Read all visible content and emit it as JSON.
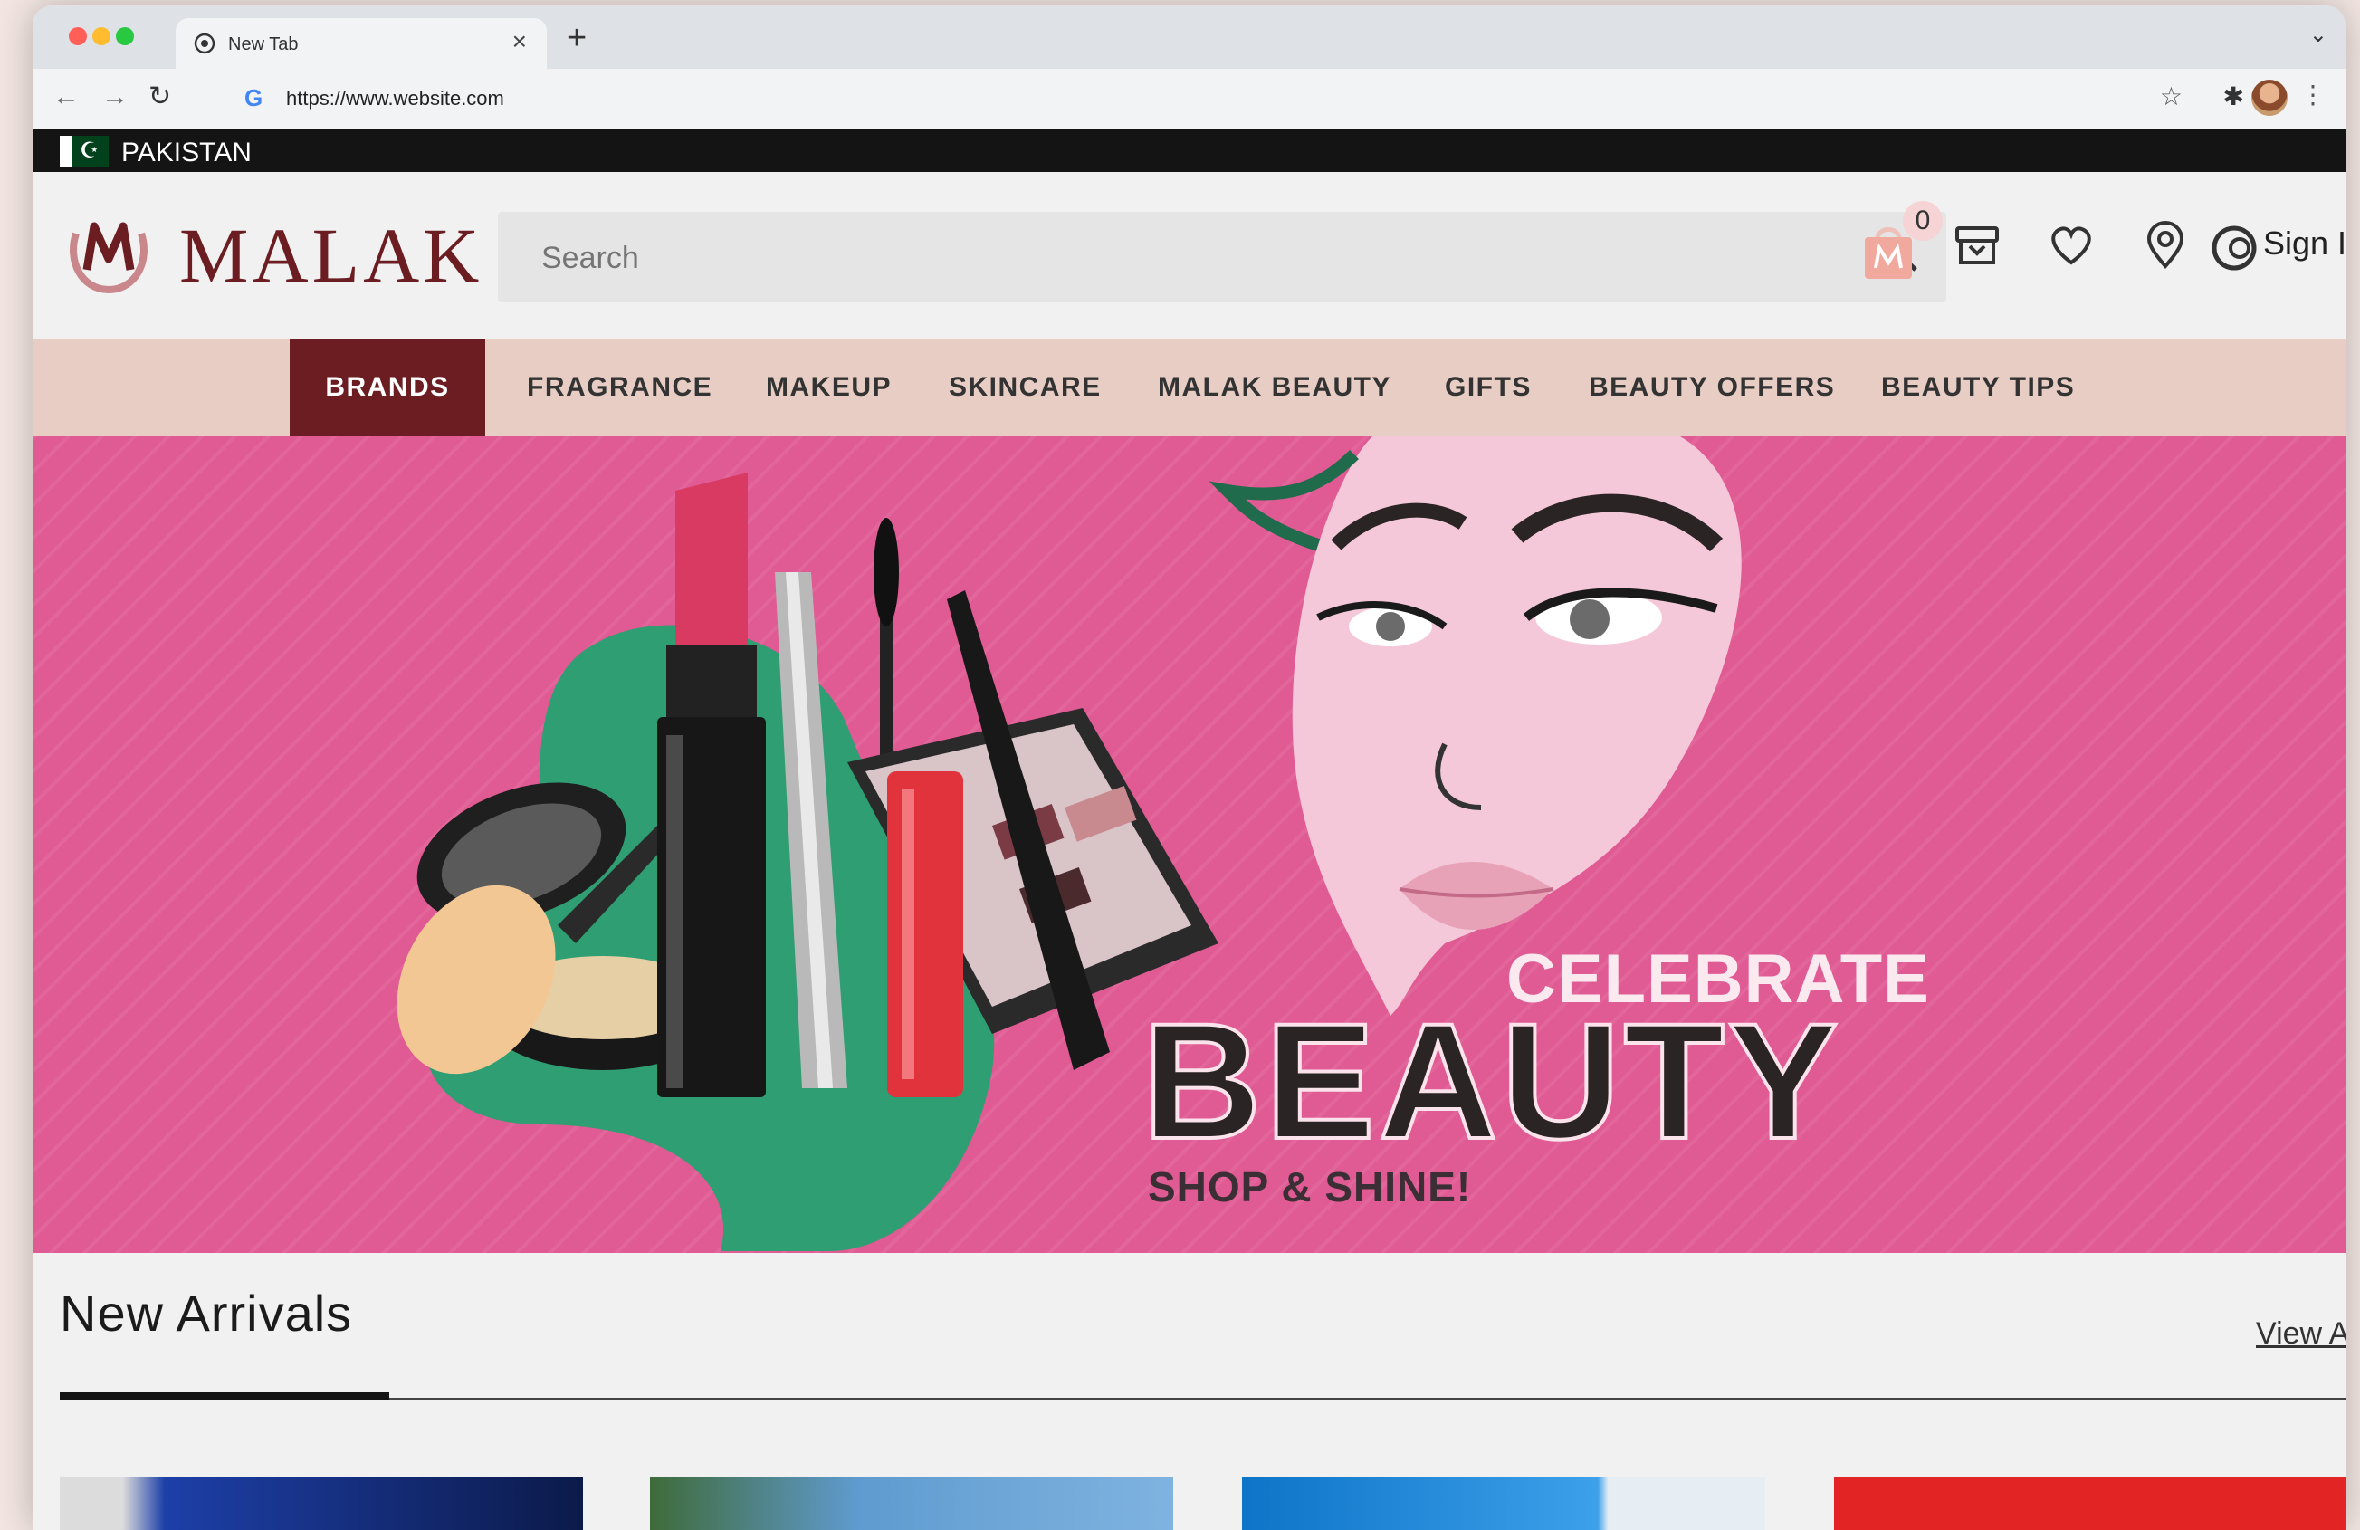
{
  "browser": {
    "tab_title": "New Tab",
    "tab_close": "×",
    "new_tab": "+",
    "url": "https://www.website.com",
    "tabs_menu": "⌄"
  },
  "site": {
    "country": "PAKISTAN",
    "logo": "MALAK",
    "search": {
      "placeholder": "Search"
    },
    "cart_count": "0",
    "sign_in": "Sign I",
    "nav": [
      "BRANDS",
      "FRAGRANCE",
      "MAKEUP",
      "SKINCARE",
      "MALAK BEAUTY",
      "GIFTS",
      "BEAUTY OFFERS",
      "BEAUTY TIPS"
    ],
    "hero": {
      "line1": "CELEBRATE",
      "line2": "BEAUTY",
      "line3": "SHOP & SHINE!"
    },
    "arrivals": {
      "title": "New Arrivals",
      "view_all": "View A"
    }
  },
  "colors": {
    "brand": "#6b1d22",
    "nav_bg": "#e7cdc3",
    "hero_bg": "#e05a93",
    "hero_green": "#2f9e73"
  },
  "icons": [
    "globe-icon",
    "close-icon",
    "plus-icon",
    "back-icon",
    "forward-icon",
    "reload-icon",
    "google-icon",
    "star-icon",
    "extensions-icon",
    "profile-avatar",
    "kebab-icon",
    "search-icon",
    "cart-icon",
    "gift-icon",
    "heart-icon",
    "location-pin-icon",
    "account-icon"
  ]
}
